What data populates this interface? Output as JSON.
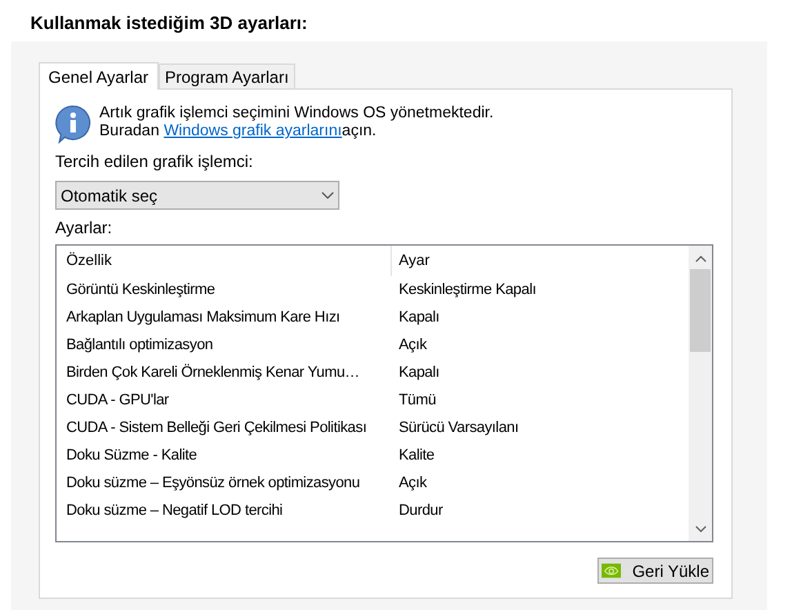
{
  "heading": "Kullanmak istediğim 3D ayarları:",
  "tabs": [
    {
      "label": "Genel Ayarlar",
      "selected": true
    },
    {
      "label": "Program Ayarları",
      "selected": false
    }
  ],
  "info": {
    "line1": "Artık grafik işlemci seçimini Windows OS yönetmektedir.",
    "line2_before": "Buradan ",
    "link": "Windows grafik ayarlarını",
    "line2_after": "açın."
  },
  "gpu_label": "Tercih edilen grafik işlemci:",
  "gpu_select": {
    "value": "Otomatik seç"
  },
  "settings_label": "Ayarlar:",
  "table": {
    "columns": [
      "Özellik",
      "Ayar"
    ],
    "rows": [
      [
        "Görüntü Keskinleştirme",
        "Keskinleştirme Kapalı"
      ],
      [
        "Arkaplan Uygulaması Maksimum Kare Hızı",
        "Kapalı"
      ],
      [
        "Bağlantılı optimizasyon",
        "Açık"
      ],
      [
        "Birden Çok Kareli Örneklenmiş Kenar Yumu…",
        "Kapalı"
      ],
      [
        "CUDA - GPU'lar",
        "Tümü"
      ],
      [
        "CUDA - Sistem Belleği Geri Çekilmesi Politikası",
        "Sürücü Varsayılanı"
      ],
      [
        "Doku Süzme - Kalite",
        "Kalite"
      ],
      [
        "Doku süzme – Eşyönsüz örnek optimizasyonu",
        "Açık"
      ],
      [
        "Doku süzme – Negatif LOD tercihi",
        "Durdur"
      ]
    ]
  },
  "restore_button": "Geri Yükle"
}
